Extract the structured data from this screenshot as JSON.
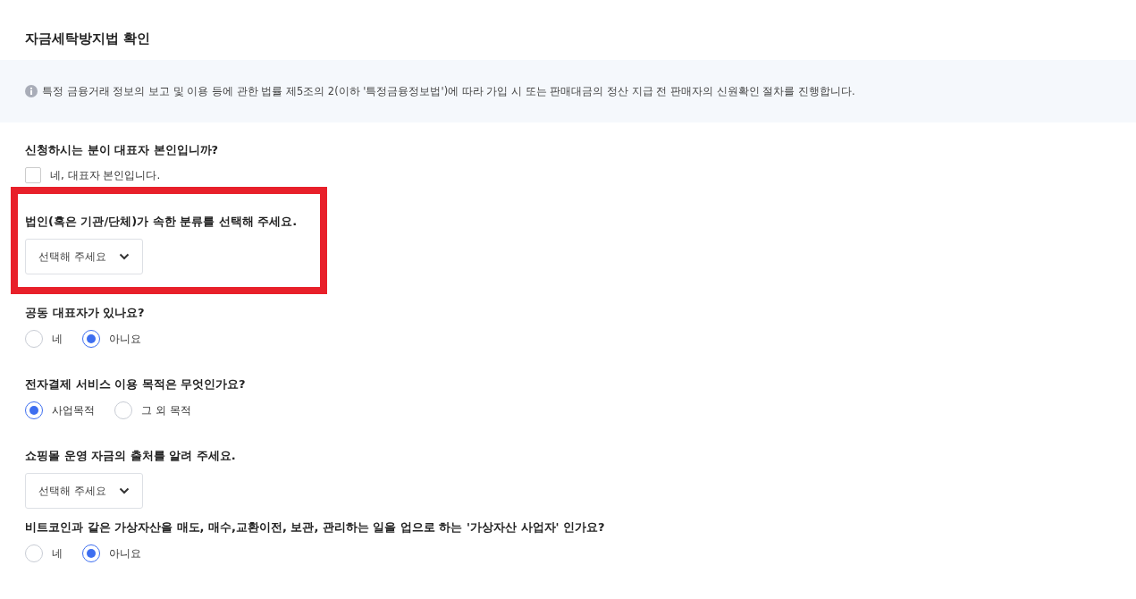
{
  "title": "자금세탁방지법 확인",
  "notice": {
    "text": "특정 금융거래 정보의 보고 및 이용 등에 관한 법률 제5조의 2(이하 '특정금융정보법')에 따라 가입 시 또는 판매대금의 정산 지급 전 판매자의 신원확인 절차를 진행합니다."
  },
  "questions": [
    {
      "kind": "checkbox",
      "label": "신청하시는 분이 대표자 본인입니까?",
      "highlighted": false,
      "option": {
        "label": "네, 대표자 본인입니다.",
        "checked": false
      }
    },
    {
      "kind": "select",
      "label": "법인(혹은 기관/단체)가 속한 분류를 선택해 주세요.",
      "highlighted": true,
      "placeholder": "선택해 주세요"
    },
    {
      "kind": "radio",
      "label": "공동 대표자가 있나요?",
      "highlighted": false,
      "options": [
        {
          "label": "네",
          "selected": false
        },
        {
          "label": "아니요",
          "selected": true
        }
      ]
    },
    {
      "kind": "radio",
      "label": "전자결제 서비스 이용 목적은 무엇인가요?",
      "highlighted": false,
      "options": [
        {
          "label": "사업목적",
          "selected": true
        },
        {
          "label": "그 외 목적",
          "selected": false
        }
      ]
    },
    {
      "kind": "select",
      "label": "쇼핑몰 운영 자금의 출처를 알려 주세요.",
      "highlighted": false,
      "placeholder": "선택해 주세요"
    },
    {
      "kind": "radio",
      "label": "비트코인과 같은 가상자산을 매도, 매수,교환이전, 보관, 관리하는 일을 업으로 하는 '가상자산 사업자' 인가요?",
      "highlighted": false,
      "options": [
        {
          "label": "네",
          "selected": false
        },
        {
          "label": "아니요",
          "selected": true
        }
      ]
    }
  ]
}
